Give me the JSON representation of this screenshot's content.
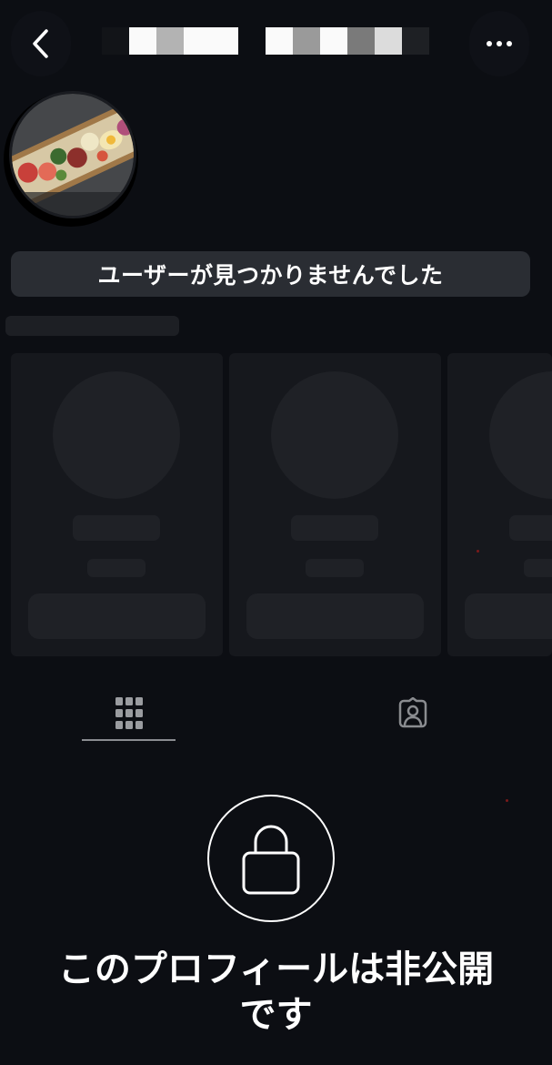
{
  "header": {
    "back_icon": "chevron-left-icon",
    "more_icon": "ellipsis-icon",
    "username_censored": "pixelated",
    "pixels_group1": [
      "#121418",
      "#fafafa",
      "#b3b3b3",
      "#fafafa",
      "#fafafa"
    ],
    "pixels_group2": [
      "#fafafa",
      "#9a9a9a",
      "#fafafa",
      "#7a7a7a",
      "#dcdcdc",
      "#1e2024"
    ]
  },
  "profile": {
    "avatar": "food-bento-photo"
  },
  "notice": {
    "text": "ユーザーが見つかりませんでした"
  },
  "suggestions": {
    "card_count": 3
  },
  "tabs": [
    {
      "icon": "grid-icon",
      "active": true
    },
    {
      "icon": "tagged-person-icon",
      "active": false
    }
  ],
  "private_notice": {
    "icon": "lock-icon",
    "line1": "このプロフィールは非公開",
    "line2": "です"
  },
  "colors": {
    "background": "#0c0e13",
    "banner": "#2a2d33",
    "skeleton": "#1d1f24",
    "text": "#ffffff"
  }
}
